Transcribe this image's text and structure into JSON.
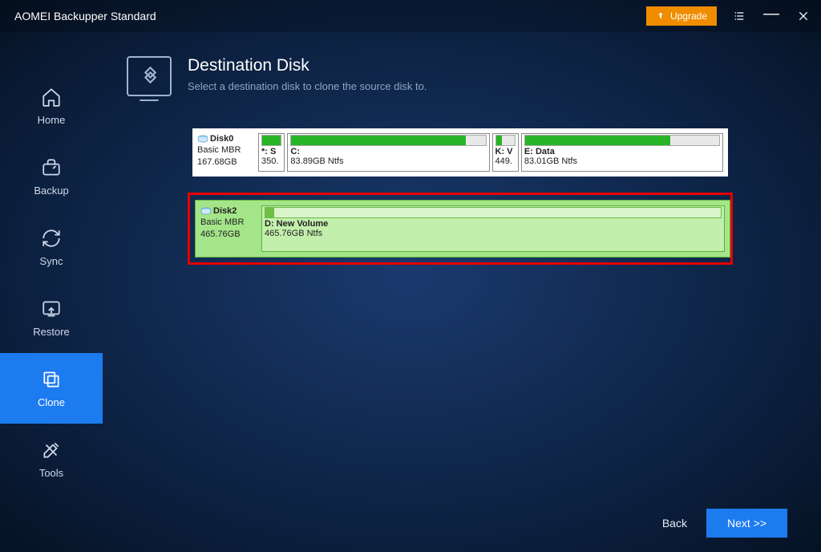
{
  "app_title": "AOMEI Backupper Standard",
  "upgrade_label": "Upgrade",
  "sidebar": {
    "items": [
      {
        "label": "Home"
      },
      {
        "label": "Backup"
      },
      {
        "label": "Sync"
      },
      {
        "label": "Restore"
      },
      {
        "label": "Clone"
      },
      {
        "label": "Tools"
      }
    ]
  },
  "page": {
    "title": "Destination Disk",
    "subtitle": "Select a destination disk to clone the source disk to."
  },
  "disks": [
    {
      "name": "Disk0",
      "type": "Basic MBR",
      "size": "167.68GB",
      "selected": false,
      "partitions": [
        {
          "label": "*: S",
          "sub": "350.",
          "fill": 100,
          "flex": 0.05
        },
        {
          "label": "C:",
          "sub": "83.89GB Ntfs",
          "fill": 90,
          "flex": 0.48
        },
        {
          "label": "K: V",
          "sub": "449.",
          "fill": 30,
          "flex": 0.05
        },
        {
          "label": "E: Data",
          "sub": "83.01GB Ntfs",
          "fill": 75,
          "flex": 0.48
        }
      ]
    },
    {
      "name": "Disk2",
      "type": "Basic MBR",
      "size": "465.76GB",
      "selected": true,
      "partitions": [
        {
          "label": "D: New Volume",
          "sub": "465.76GB Ntfs",
          "fill": 2,
          "flex": 1
        }
      ]
    }
  ],
  "footer": {
    "back": "Back",
    "next": "Next >>"
  }
}
